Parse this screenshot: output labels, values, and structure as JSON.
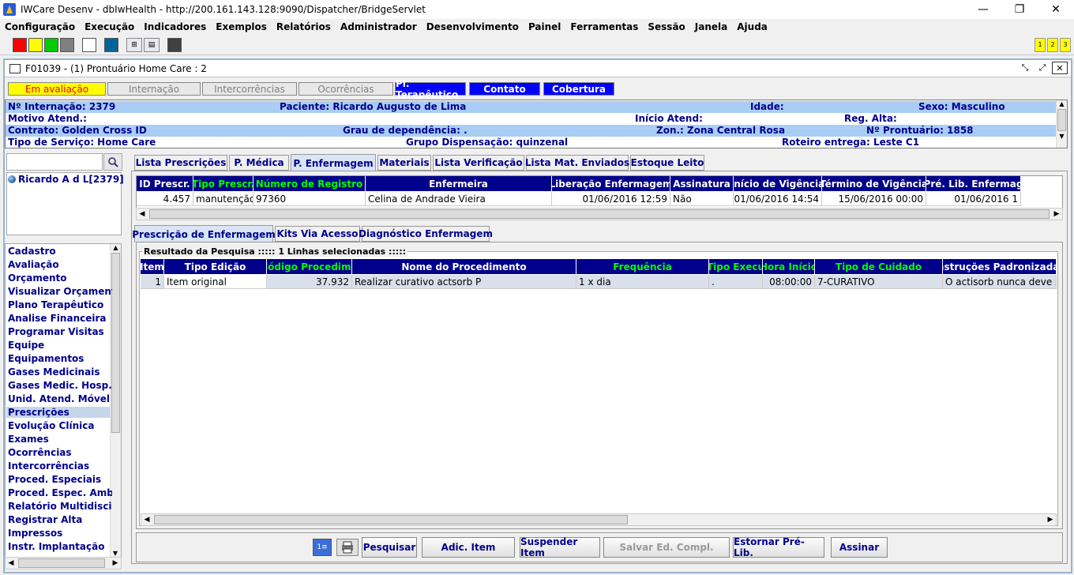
{
  "window": {
    "title": "IWCare Desenv - dbIwHealth - http://200.161.143.128:9090/Dispatcher/BridgeServlet",
    "min": "—",
    "restore": "❐",
    "close": "✕"
  },
  "menu": [
    "Configuração",
    "Execução",
    "Indicadores",
    "Exemplos",
    "Relatórios",
    "Administrador",
    "Desenvolvimento",
    "Painel",
    "Ferramentas",
    "Sessão",
    "Janela",
    "Ajuda"
  ],
  "toolbar": {
    "swatches": [
      "#ff0000",
      "#ffff00",
      "#00cc00",
      "#808080",
      "#ffffff",
      "#006699",
      "#404040"
    ],
    "window_buttons": [
      "1",
      "2",
      "3"
    ]
  },
  "frame": {
    "title": "F01039 - (1) Prontuário Home Care : 2"
  },
  "status_buttons": [
    {
      "label": "Em avaliação",
      "bg": "#ffff00",
      "fg": "#ff0000"
    },
    {
      "label": "Internação",
      "bg": "#e8e8e8",
      "fg": "#808080"
    },
    {
      "label": "Intercorrências",
      "bg": "#e8e8e8",
      "fg": "#808080"
    },
    {
      "label": "Ocorrências",
      "bg": "#e8e8e8",
      "fg": "#808080"
    },
    {
      "label": "Pl. Terapêutico",
      "bg": "#0000ff",
      "fg": "#ffffff"
    },
    {
      "label": "Contato",
      "bg": "#0000ff",
      "fg": "#ffffff"
    },
    {
      "label": "Cobertura",
      "bg": "#0000ff",
      "fg": "#ffffff"
    }
  ],
  "info": {
    "r1": [
      "Nº Internação: 2379",
      "Paciente: Ricardo Augusto de Lima",
      "Idade:",
      "Sexo: Masculino"
    ],
    "r2": [
      "Motivo Atend.:",
      "Início Atend:",
      "Reg. Alta:"
    ],
    "r3": [
      "Contrato: Golden Cross ID",
      "Grau de dependência: .",
      "Zon.: Zona Central Rosa",
      "Nº Prontuário: 1858"
    ],
    "r4": [
      "Tipo de Serviço: Home Care",
      "Grupo Dispensação: quinzenal",
      "Roteiro entrega: Leste C1"
    ]
  },
  "patient": {
    "name": "Ricardo A d L[2379]"
  },
  "nav": [
    "Cadastro",
    "Avaliação",
    "Orçamento",
    "Visualizar Orçamento",
    "Plano Terapêutico",
    "Analise Financeira",
    "Programar Visitas",
    "Equipe",
    "Equipamentos",
    "Gases Medicinais",
    "Gases Medic. Hosp.",
    "Unid. Atend. Móvel",
    "Prescrições",
    "Evolução Clínica",
    "Exames",
    "Ocorrências",
    "Intercorrências",
    "Proced. Especiais",
    "Proced. Espec. Amb.",
    "Relatório Multidisciplinar",
    "Registrar Alta",
    "Impressos",
    "Instr. Implantação"
  ],
  "nav_selected": "Prescrições",
  "tabs": [
    "Lista Prescrições",
    "P. Médica",
    "P. Enfermagem",
    "Materiais",
    "Lista Verificação",
    "Lista Mat. Enviados",
    "Estoque Leito"
  ],
  "tab_active": "P. Enfermagem",
  "grid1": {
    "headers": [
      "ID Prescr.",
      "Tipo Prescr.",
      "Número de Registro",
      "Enfermeira",
      "Liberação Enfermagem",
      "Assinatura",
      "Início de Vigência",
      "Término de Vigência",
      "Pré. Lib. Enfermag"
    ],
    "green": [
      false,
      true,
      true,
      false,
      false,
      false,
      false,
      false,
      false
    ],
    "rows": [
      [
        "4.457",
        "manutenção",
        "97360",
        "Celina de Andrade Vieira",
        "01/06/2016 12:59",
        "Não",
        "01/06/2016 14:54",
        "15/06/2016 00:00",
        "01/06/2016 1"
      ]
    ]
  },
  "subtabs": [
    "Prescrição de Enfermagem",
    "Kits Via Acesso",
    "Diagnóstico Enfermagem"
  ],
  "result_label": "Resultado da Pesquisa ::::: 1 Linhas selecionadas :::::",
  "grid2": {
    "headers": [
      "Item",
      "Tipo Edição",
      "Código Procedime",
      "Nome do Procedimento",
      "Frequência",
      "Tipo Execu",
      "Hora Início",
      "Tipo de Cuidado",
      "Instruções Padronizadas"
    ],
    "green": [
      false,
      false,
      true,
      false,
      true,
      true,
      true,
      true,
      false
    ],
    "rows": [
      [
        "1",
        "Item original",
        "37.932",
        "Realizar curativo actsorb P",
        "1 x dia",
        ".",
        "08:00:00",
        "7-CURATIVO",
        "O actisorb nunca deve se..."
      ]
    ]
  },
  "buttons": [
    "Pesquisar",
    "Adic. Item",
    "Suspender Item",
    "Salvar Ed. Compl.",
    "Estornar Pré-Lib.",
    "Assinar"
  ],
  "buttons_disabled": [
    "Salvar Ed. Compl."
  ]
}
